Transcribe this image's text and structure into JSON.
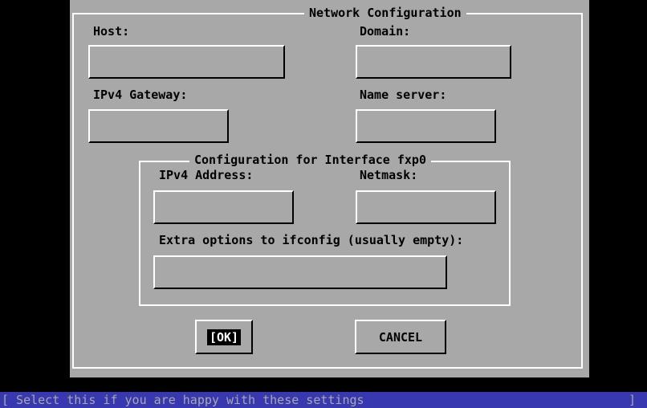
{
  "dialog": {
    "title": "Network Configuration",
    "fields": {
      "host": {
        "label": "Host:",
        "value": ""
      },
      "domain": {
        "label": "Domain:",
        "value": ""
      },
      "gateway": {
        "label": "IPv4 Gateway:",
        "value": ""
      },
      "nameserver": {
        "label": "Name server:",
        "value": ""
      }
    },
    "interface": {
      "title": "Configuration for Interface fxp0",
      "ipv4": {
        "label": "IPv4 Address:",
        "value": ""
      },
      "netmask": {
        "label": "Netmask:",
        "value": ""
      },
      "extra": {
        "label": "Extra options to ifconfig (usually empty):",
        "value": ""
      }
    },
    "buttons": {
      "ok": "[OK]",
      "cancel": "CANCEL"
    }
  },
  "statusbar": {
    "text": "[ Select this if you are happy with these settings",
    "end": "]"
  },
  "colors": {
    "background": "#000000",
    "dialog": "#a8a8a8",
    "statusbar": "#3838b0"
  }
}
